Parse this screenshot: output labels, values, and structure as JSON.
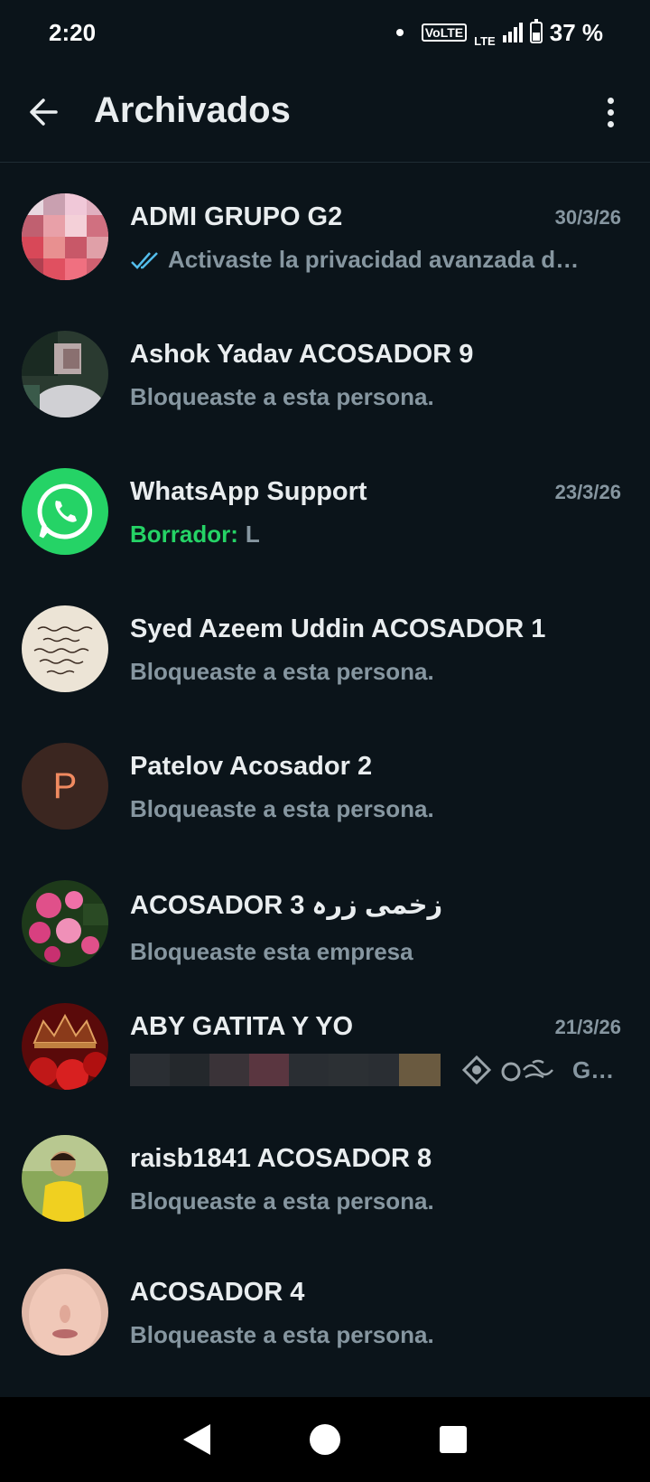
{
  "status_bar": {
    "time": "2:20",
    "volte": "VoLTE",
    "lte": "LTE",
    "battery": "37 %"
  },
  "app_bar": {
    "title": "Archivados"
  },
  "chats": [
    {
      "name": "ADMI GRUPO G2",
      "date": "30/3/26",
      "message": "Activaste la privacidad avanzada d…",
      "avatar": "blurred-photo",
      "ticks": true
    },
    {
      "name": "Ashok Yadav ACOSADOR 9",
      "date": "",
      "message": "Bloqueaste a esta persona.",
      "avatar": "blurred-photo"
    },
    {
      "name": "WhatsApp Support",
      "date": "23/3/26",
      "draft_label": "Borrador:",
      "message": "L",
      "avatar": "whatsapp-logo"
    },
    {
      "name": "Syed Azeem Uddin ACOSADOR 1",
      "date": "",
      "message": "Bloqueaste a esta persona.",
      "avatar": "text-image"
    },
    {
      "name": "Patelov Acosador 2",
      "date": "",
      "message": "Bloqueaste a esta persona.",
      "avatar": "letter",
      "avatar_letter": "P"
    },
    {
      "name": "ACOSADOR 3 زخمی زرہ",
      "date": "",
      "message": "Bloqueaste esta empresa",
      "avatar": "flowers-photo"
    },
    {
      "name": "ABY GATITA Y YO",
      "date": "21/3/26",
      "message": "G…",
      "avatar": "roses-photo",
      "pixelated": true
    },
    {
      "name": "raisb1841 ACOSADOR 8",
      "date": "",
      "message": "Bloqueaste a esta persona.",
      "avatar": "person-photo"
    },
    {
      "name": "ACOSADOR 4",
      "date": "",
      "message": "Bloqueaste a esta persona.",
      "avatar": "face-photo"
    }
  ],
  "colors": {
    "background": "#0b141a",
    "accent": "#25d366",
    "secondary_text": "#8696a0",
    "tick": "#53bdeb"
  }
}
